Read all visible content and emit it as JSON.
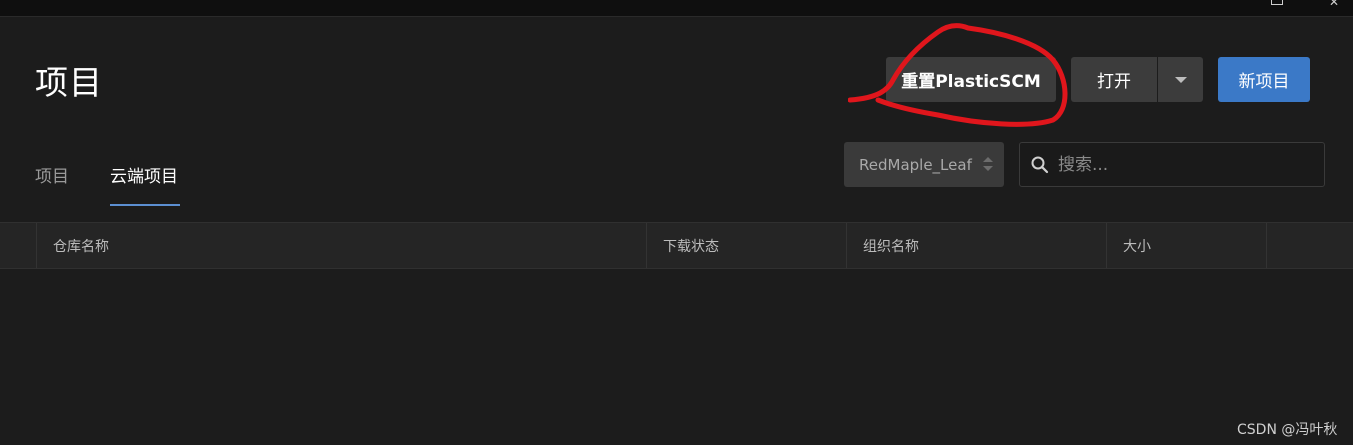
{
  "window": {
    "maximize_icon": "maximize-icon",
    "close_icon": "close-icon"
  },
  "header": {
    "title": "项目",
    "reset_button": "重置PlasticSCM",
    "open_button": "打开",
    "new_button": "新项目"
  },
  "tabs": [
    {
      "label": "项目",
      "active": false
    },
    {
      "label": "云端项目",
      "active": true
    }
  ],
  "organization": {
    "selected": "RedMaple_Leaf"
  },
  "search": {
    "placeholder": "搜索..."
  },
  "table": {
    "columns": [
      "仓库名称",
      "下载状态",
      "组织名称",
      "大小"
    ],
    "rows": []
  },
  "watermark": "CSDN @冯叶秋",
  "colors": {
    "background": "#1c1c1c",
    "accent": "#3b79c7",
    "annotation": "#e0161c"
  }
}
